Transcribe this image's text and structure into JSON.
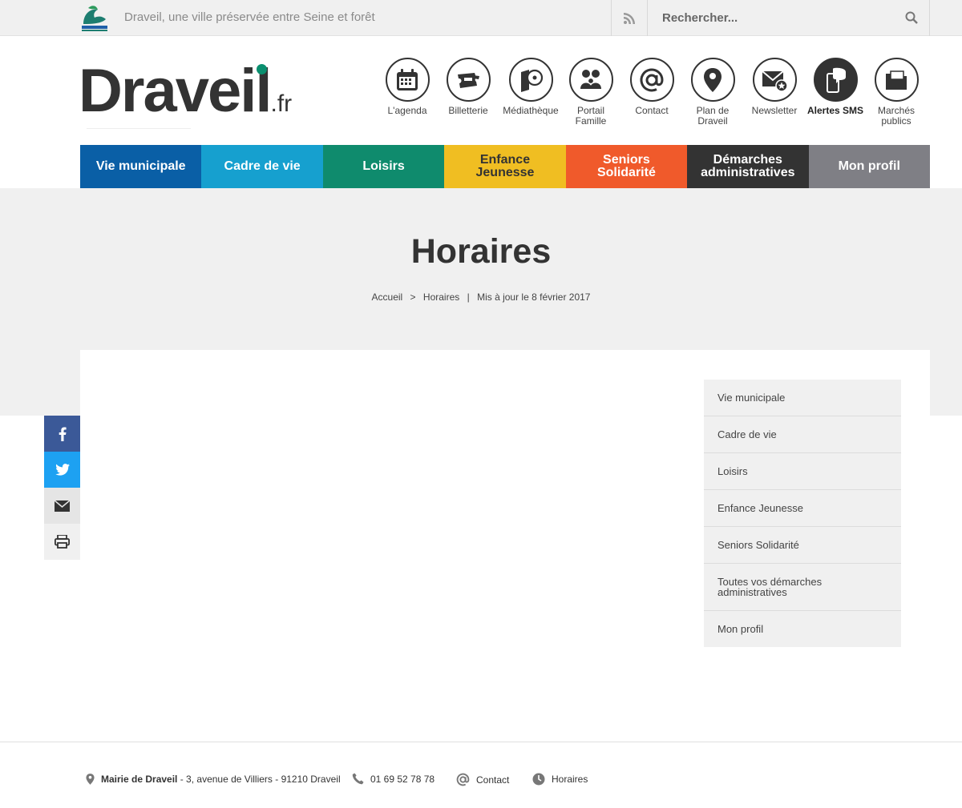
{
  "topbar": {
    "tagline": "Draveil, une ville préservée entre Seine et forêt",
    "search_placeholder": "Rechercher..."
  },
  "logo": {
    "word": "Draveil",
    "tld": ".fr"
  },
  "quick_links": [
    {
      "label": "L'agenda",
      "icon": "calendar-icon"
    },
    {
      "label": "Billetterie",
      "icon": "ticket-icon"
    },
    {
      "label": "Médiathèque",
      "icon": "book-disc-icon"
    },
    {
      "label": "Portail Famille",
      "icon": "family-icon"
    },
    {
      "label": "Contact",
      "icon": "at-icon"
    },
    {
      "label": "Plan de Draveil",
      "icon": "map-pin-icon"
    },
    {
      "label": "Newsletter",
      "icon": "envelope-star-icon"
    },
    {
      "label": "Alertes SMS",
      "icon": "phone-bubble-icon"
    },
    {
      "label": "Marchés publics",
      "icon": "folder-icon"
    }
  ],
  "nav": [
    {
      "label": "Vie municipale",
      "color": "#0a5fa6"
    },
    {
      "label": "Cadre de vie",
      "color": "#16a0cf"
    },
    {
      "label": "Loisirs",
      "color": "#0f8b6d"
    },
    {
      "label": "Enfance Jeunesse",
      "color": "#f0be22"
    },
    {
      "label": "Seniors Solidarité",
      "color": "#f05a2b"
    },
    {
      "label": "Démarches administratives",
      "color": "#333333"
    },
    {
      "label": "Mon profil",
      "color": "#7f7f85"
    }
  ],
  "page": {
    "title": "Horaires",
    "breadcrumb_home": "Accueil",
    "breadcrumb_sep": ">",
    "breadcrumb_current": "Horaires",
    "breadcrumb_pipe": "|",
    "updated": "Mis à jour le 8 février 2017"
  },
  "sidebar": [
    "Vie municipale",
    "Cadre de vie",
    "Loisirs",
    "Enfance Jeunesse",
    "Seniors Solidarité",
    "Toutes vos démarches administratives",
    "Mon profil"
  ],
  "share": [
    "facebook-icon",
    "twitter-icon",
    "mail-icon",
    "print-icon"
  ],
  "share_colors": {
    "facebook": "#3b5998",
    "twitter": "#1da1f2"
  },
  "footer": {
    "org": "Mairie de Draveil",
    "address": " - 3, avenue de Villiers - 91210 Draveil",
    "phone": "01 69 52 78 78",
    "contact": "Contact",
    "hours": "Horaires"
  }
}
